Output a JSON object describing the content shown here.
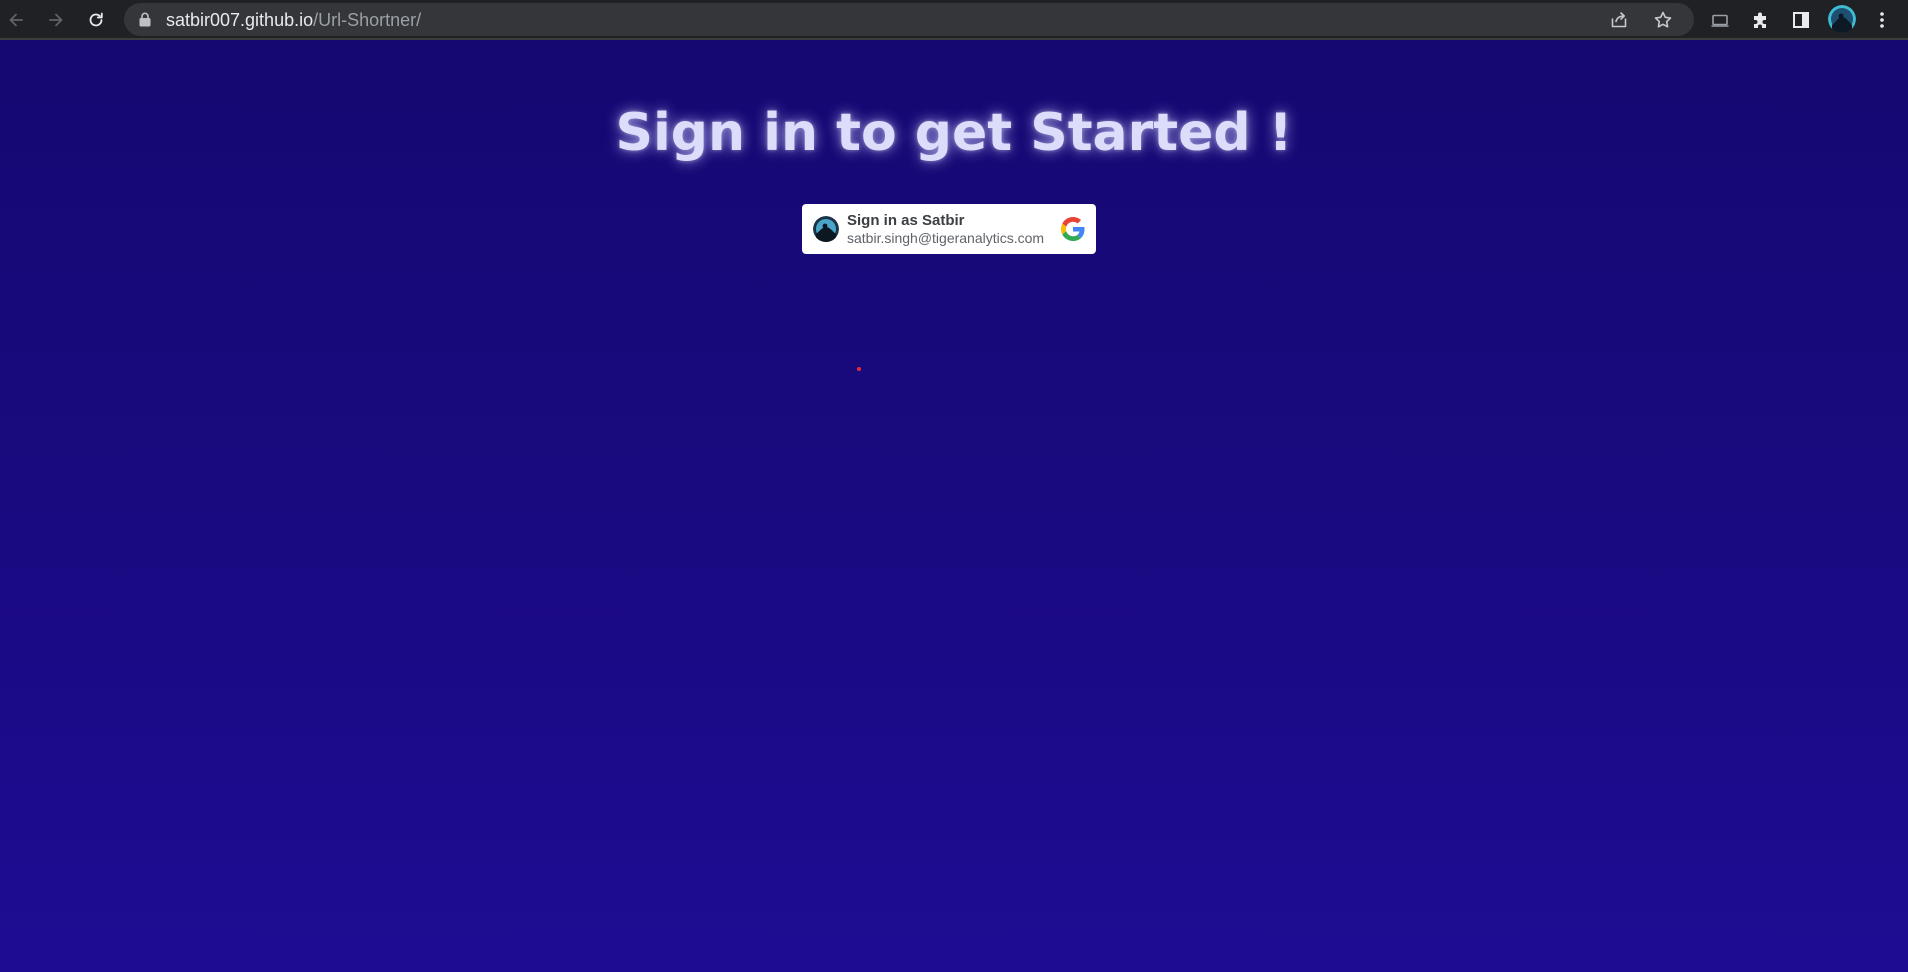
{
  "browser": {
    "url_host": "satbir007.github.io",
    "url_path": "/Url-Shortner/",
    "icons": {
      "back": "arrow-left-icon",
      "forward": "arrow-right-icon",
      "reload": "reload-icon",
      "lock": "lock-icon",
      "share": "share-icon",
      "bookmark": "star-icon",
      "cast": "cast-icon",
      "extensions": "puzzle-icon",
      "side_panel": "side-panel-icon",
      "profile": "avatar",
      "menu": "kebab-menu-icon"
    }
  },
  "page": {
    "heading": "Sign in to get Started !",
    "google_signin": {
      "title": "Sign in as Satbir",
      "email": "satbir.singh@tigeranalytics.com"
    }
  },
  "colors": {
    "background_top": "#150871",
    "background_bottom": "#1e0c93",
    "heading": "#dcdcfb",
    "button_bg": "#ffffff",
    "chrome_bg": "#202124",
    "omnibox_bg": "#35363a",
    "dot": "#e8283a"
  }
}
